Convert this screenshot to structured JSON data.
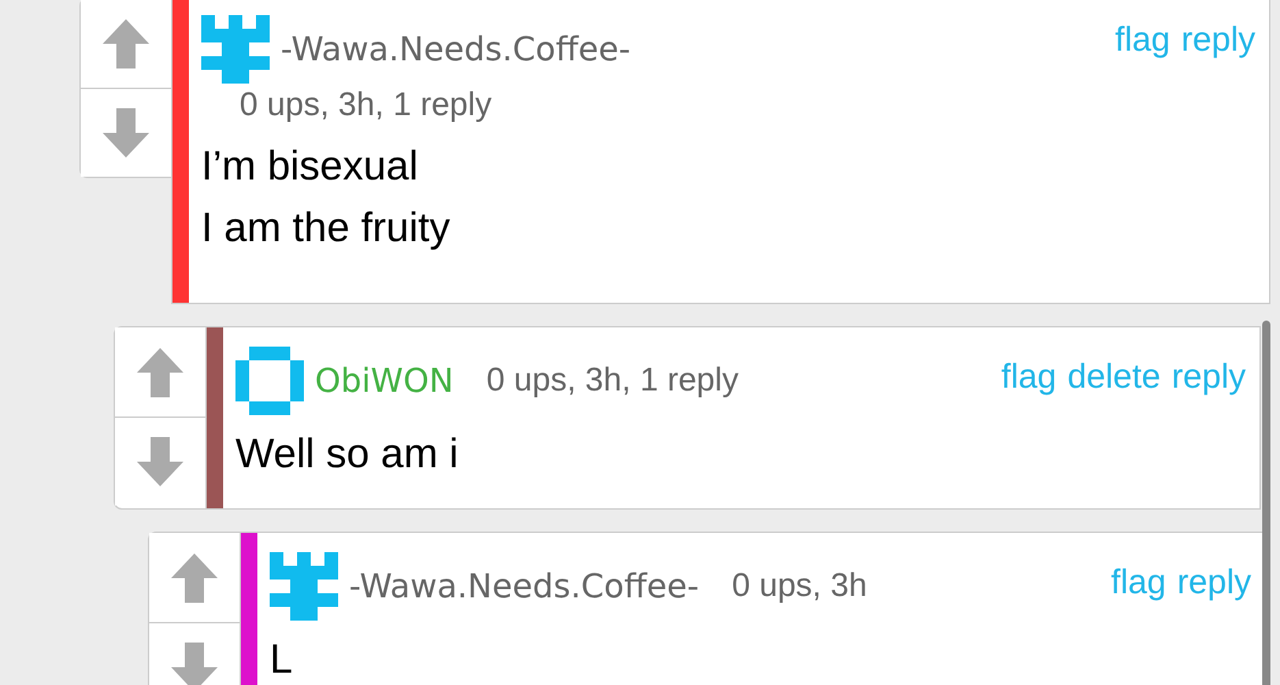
{
  "comments": [
    {
      "kind": "top",
      "color": "#ff3333",
      "avatar": {
        "kind": "cross"
      },
      "user": {
        "name": "-Wawa.Needs.Coffee-",
        "color": "#666666"
      },
      "meta": "0 ups, 3h, 1 reply",
      "actions": [
        "flag",
        "reply"
      ],
      "body": [
        "I’m bisexual",
        "I am the fruity"
      ]
    },
    {
      "kind": "reply",
      "color": "#9b5555",
      "avatar": {
        "kind": "ring"
      },
      "user": {
        "name": "ObiWON",
        "color": "#44b244"
      },
      "meta": "0 ups, 3h, 1 reply",
      "actions": [
        "flag",
        "delete",
        "reply"
      ],
      "body": [
        "Well so am i"
      ]
    },
    {
      "kind": "reply",
      "color": "#dd11cc",
      "avatar": {
        "kind": "cross"
      },
      "user": {
        "name": "-Wawa.Needs.Coffee-",
        "color": "#666666"
      },
      "meta": "0 ups, 3h",
      "actions": [
        "flag",
        "reply"
      ],
      "body": [
        "L"
      ]
    }
  ]
}
